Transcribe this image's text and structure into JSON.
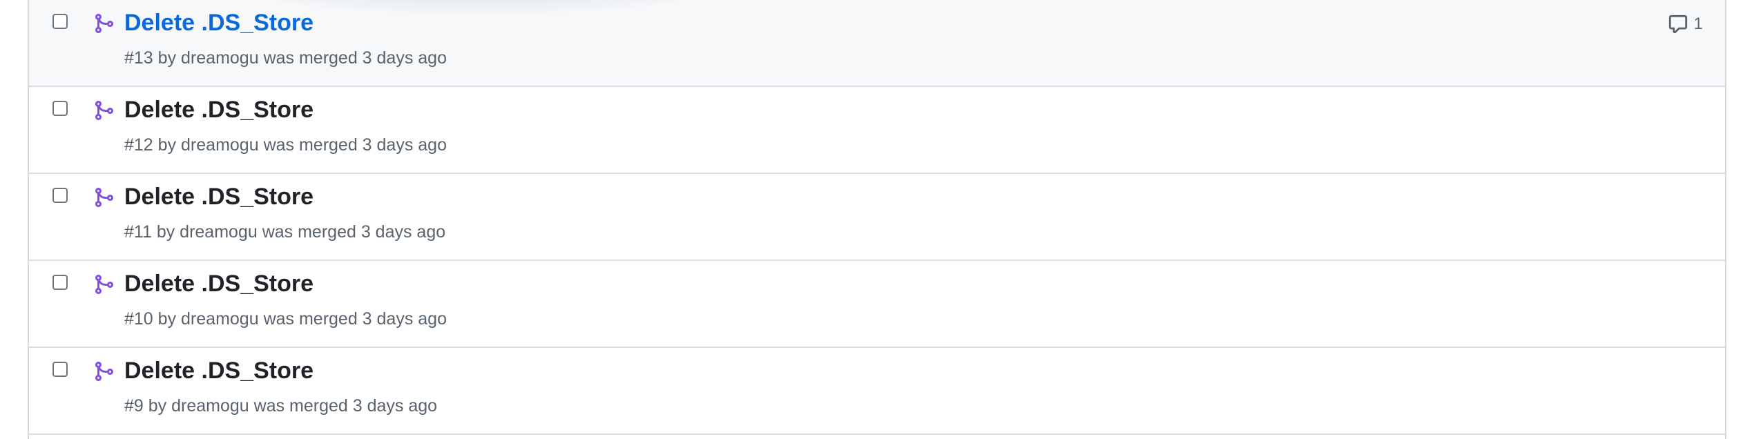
{
  "pull_requests": [
    {
      "title": "Delete .DS_Store",
      "number": "#13",
      "by_word": "by",
      "author": "dreamogu",
      "status": "was merged 3 days ago",
      "comments": "1",
      "hover": true
    },
    {
      "title": "Delete .DS_Store",
      "number": "#12",
      "by_word": "by",
      "author": "dreamogu",
      "status": "was merged 3 days ago",
      "comments": "",
      "hover": false
    },
    {
      "title": "Delete .DS_Store",
      "number": "#11",
      "by_word": "by",
      "author": "dreamogu",
      "status": "was merged 3 days ago",
      "comments": "",
      "hover": false
    },
    {
      "title": "Delete .DS_Store",
      "number": "#10",
      "by_word": "by",
      "author": "dreamogu",
      "status": "was merged 3 days ago",
      "comments": "",
      "hover": false
    },
    {
      "title": "Delete .DS_Store",
      "number": "#9",
      "by_word": "by",
      "author": "dreamogu",
      "status": "was merged 3 days ago",
      "comments": "",
      "hover": false
    }
  ],
  "icons": {
    "merged": "git-merge-icon",
    "comment": "comment-icon"
  },
  "colors": {
    "merged_purple": "#8250df",
    "link_blue": "#0969da",
    "muted_text": "#59636e",
    "title_text": "#1f2328",
    "hover_bg": "#f6f8fa",
    "border": "#d8dee4"
  }
}
